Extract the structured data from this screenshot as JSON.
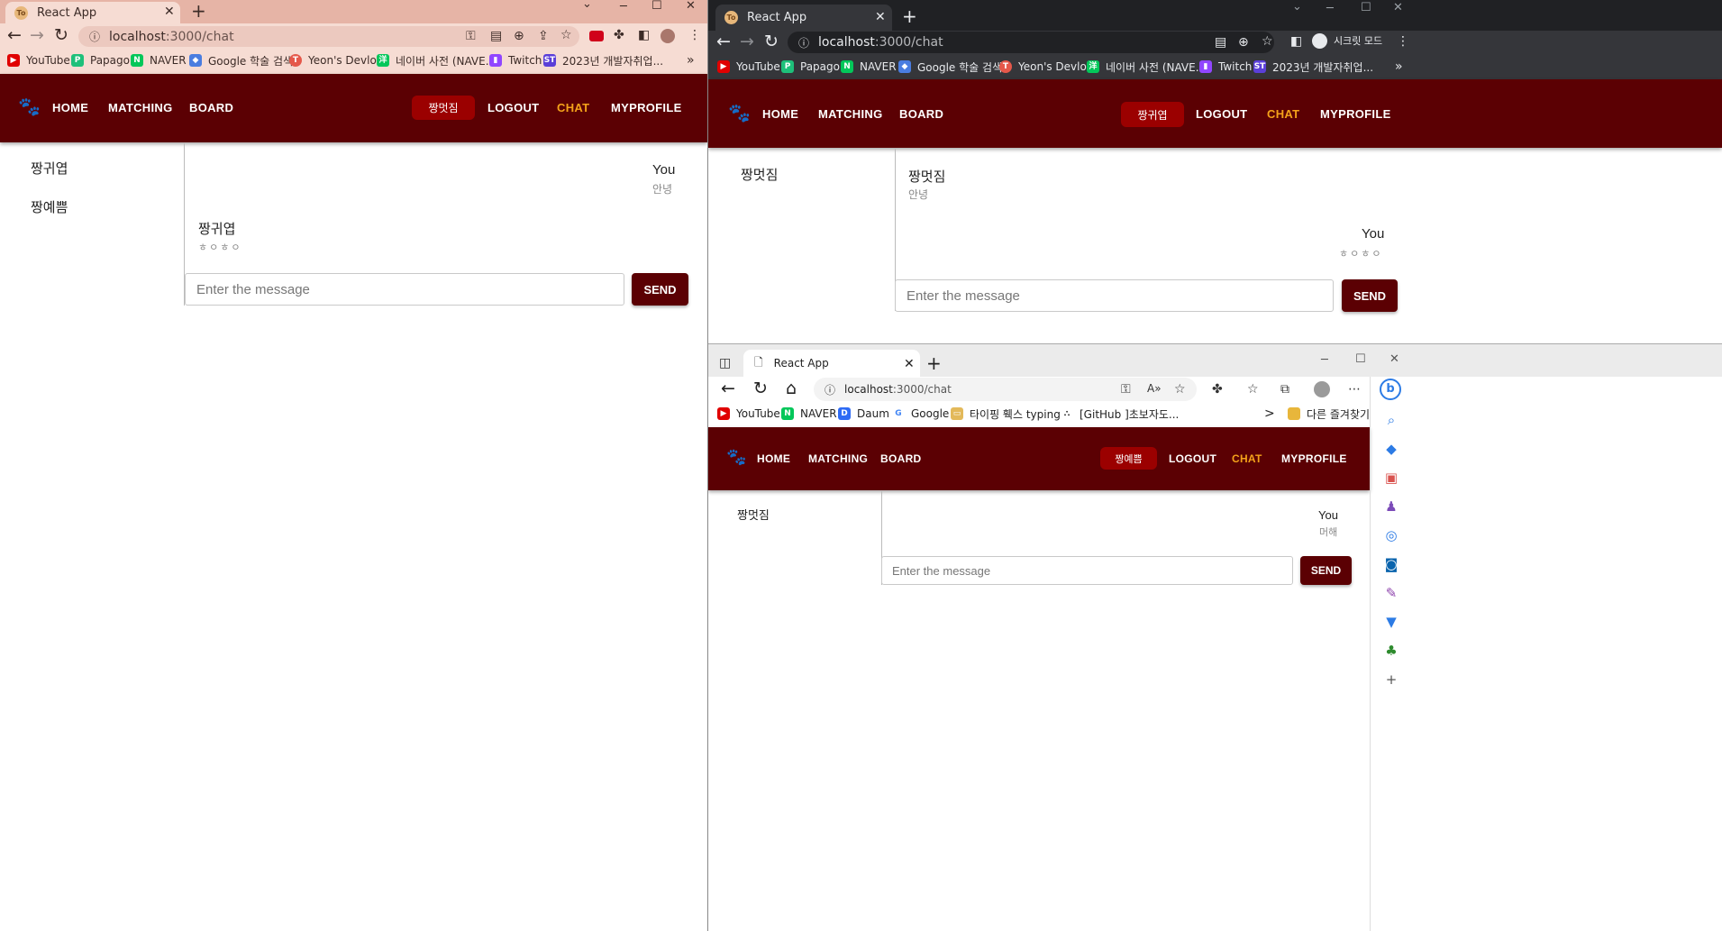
{
  "windows": [
    {
      "browser": "Chrome",
      "tab_title": "React App",
      "tab_favicon": "To",
      "url_host": "localhost",
      "url_path": ":3000/chat",
      "bookmarks": [
        "YouTube",
        "Papago",
        "NAVER",
        "Google 학술 검색",
        "Yeon's Devlog",
        "네이버 사전 (NAVE...",
        "Twitch",
        "2023년 개발자취업..."
      ],
      "bookmarks_more": "»",
      "nav": {
        "home": "HOME",
        "matching": "MATCHING",
        "board": "BOARD",
        "user": "짱멋짐",
        "logout": "LOGOUT",
        "chat": "CHAT",
        "myprofile": "MYPROFILE"
      },
      "contacts": [
        "짱귀엽",
        "짱예쁨"
      ],
      "messages": [
        {
          "sender": "You",
          "text": "안녕",
          "mine": true
        },
        {
          "sender": "짱귀엽",
          "text": "ㅎㅇㅎㅇ",
          "mine": false
        }
      ],
      "input_placeholder": "Enter the message",
      "send_label": "SEND"
    },
    {
      "browser": "Chrome Incognito",
      "tab_title": "React App",
      "tab_favicon": "To",
      "url_host": "localhost",
      "url_path": ":3000/chat",
      "incognito_label": "시크릿 모드",
      "bookmarks": [
        "YouTube",
        "Papago",
        "NAVER",
        "Google 학술 검색",
        "Yeon's Devlog",
        "네이버 사전 (NAVE...",
        "Twitch",
        "2023년 개발자취업..."
      ],
      "bookmarks_more": "»",
      "nav": {
        "home": "HOME",
        "matching": "MATCHING",
        "board": "BOARD",
        "user": "짱귀엽",
        "logout": "LOGOUT",
        "chat": "CHAT",
        "myprofile": "MYPROFILE"
      },
      "contacts": [
        "짱멋짐"
      ],
      "messages": [
        {
          "sender": "짱멋짐",
          "text": "안녕",
          "mine": false
        },
        {
          "sender": "You",
          "text": "ㅎㅇㅎㅇ",
          "mine": true
        }
      ],
      "input_placeholder": "Enter the message",
      "send_label": "SEND"
    },
    {
      "browser": "Edge",
      "tab_title": "React App",
      "url_host": "localhost",
      "url_path": ":3000/chat",
      "bookmarks": [
        "YouTube",
        "NAVER",
        "Daum",
        "Google",
        "타이핑 훽스 typing...",
        "[GitHub ]초보자도..."
      ],
      "bookmarks_more": ">",
      "other_favorites": "다른 즐겨찾기",
      "nav": {
        "home": "HOME",
        "matching": "MATCHING",
        "board": "BOARD",
        "user": "짱예쁨",
        "logout": "LOGOUT",
        "chat": "CHAT",
        "myprofile": "MYPROFILE"
      },
      "contacts": [
        "짱멋짐"
      ],
      "messages": [
        {
          "sender": "You",
          "text": "머해",
          "mine": true
        }
      ],
      "input_placeholder": "Enter the message",
      "send_label": "SEND"
    }
  ],
  "colors": {
    "navbar": "#5b0003",
    "user_badge": "#9b0000",
    "chat_active": "#f4a21a",
    "chrome1_frame": "#e6b4a6",
    "chrome1_toolbar": "#f6dcd3",
    "incognito_frame": "#202124",
    "incognito_toolbar": "#35363a",
    "edge_frame": "#f3f3f3"
  },
  "icons": [
    "paw-icon",
    "back-icon",
    "forward-icon",
    "reload-icon",
    "home-icon",
    "star-icon",
    "extensions-icon",
    "menu-icon",
    "bing-icon",
    "search-icon",
    "tag-icon",
    "briefcase-icon",
    "games-icon",
    "office-icon",
    "outlook-icon",
    "tree-icon",
    "add-icon"
  ]
}
